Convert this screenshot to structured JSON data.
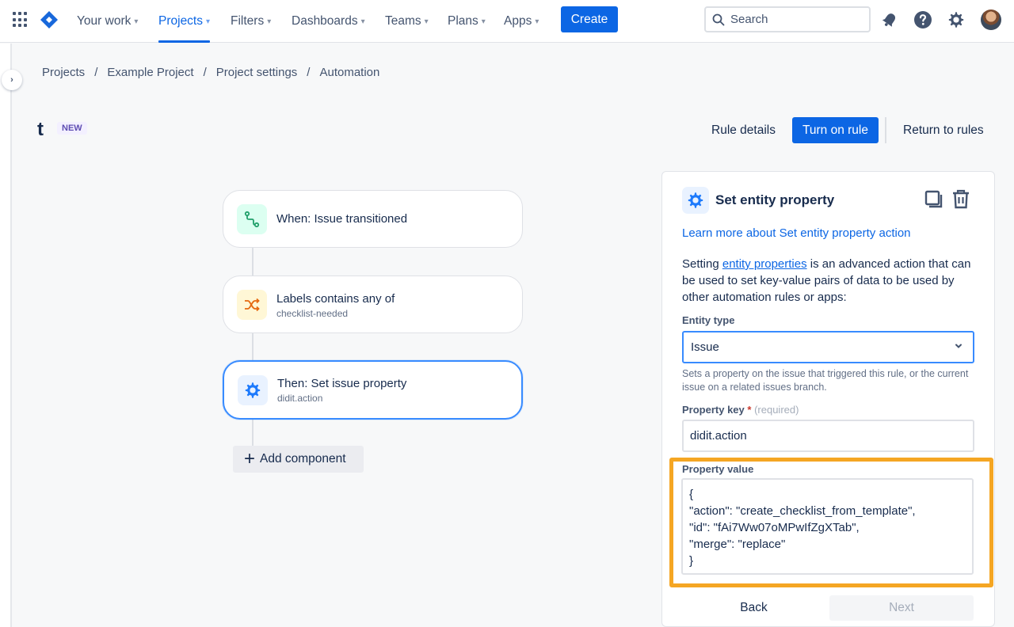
{
  "nav": {
    "items": [
      {
        "label": "Your work",
        "active": false
      },
      {
        "label": "Projects",
        "active": true
      },
      {
        "label": "Filters",
        "active": false
      },
      {
        "label": "Dashboards",
        "active": false
      },
      {
        "label": "Teams",
        "active": false
      },
      {
        "label": "Plans",
        "active": false
      },
      {
        "label": "Apps",
        "active": false
      }
    ],
    "create_label": "Create",
    "search_placeholder": "Search",
    "chevron": "⌄"
  },
  "breadcrumb": [
    "Projects",
    "Example Project",
    "Project settings",
    "Automation"
  ],
  "rule": {
    "title": "t",
    "badge": "NEW",
    "rule_details_label": "Rule details",
    "turn_on_label": "Turn on rule",
    "return_label": "Return to rules"
  },
  "flow": {
    "cards": [
      {
        "title": "When: Issue transitioned",
        "subtitle": "",
        "icon": "transition-icon",
        "icon_color": "#22a06b",
        "icon_bg": "#dcfff1"
      },
      {
        "title": "Labels contains any of",
        "subtitle": "checklist-needed",
        "icon": "shuffle-icon",
        "icon_color": "#e56910",
        "icon_bg": "#fff7d6"
      },
      {
        "title": "Then: Set issue property",
        "subtitle": "didit.action",
        "icon": "gear-icon",
        "icon_color": "#1d7afc",
        "icon_bg": "#e9f2ff"
      }
    ],
    "add_component_label": "Add component"
  },
  "panel": {
    "title": "Set entity property",
    "learn_more": "Learn more about Set entity property action",
    "desc_prefix": "Setting ",
    "desc_link": "entity properties",
    "desc_suffix": " is an advanced action that can be used to set key-value pairs of data to be used by other automation rules or apps:",
    "entity_type_label": "Entity type",
    "entity_type_value": "Issue",
    "entity_type_help": "Sets a property on the issue that triggered this rule, or the current issue on a related issues branch.",
    "property_key_label": "Property key",
    "required_mark": "*",
    "required_text": "(required)",
    "property_key_value": "didit.action",
    "property_value_label": "Property value",
    "property_value": "{\n\"action\": \"create_checklist_from_template\",\n\"id\": \"fAi7Ww07oMPwIfZgXTab\",\n\"merge\": \"replace\"\n}",
    "back_label": "Back",
    "next_label": "Next"
  },
  "colors": {
    "brand": "#0c66e4",
    "highlight": "#f5a623",
    "selected_border": "#388bff"
  }
}
